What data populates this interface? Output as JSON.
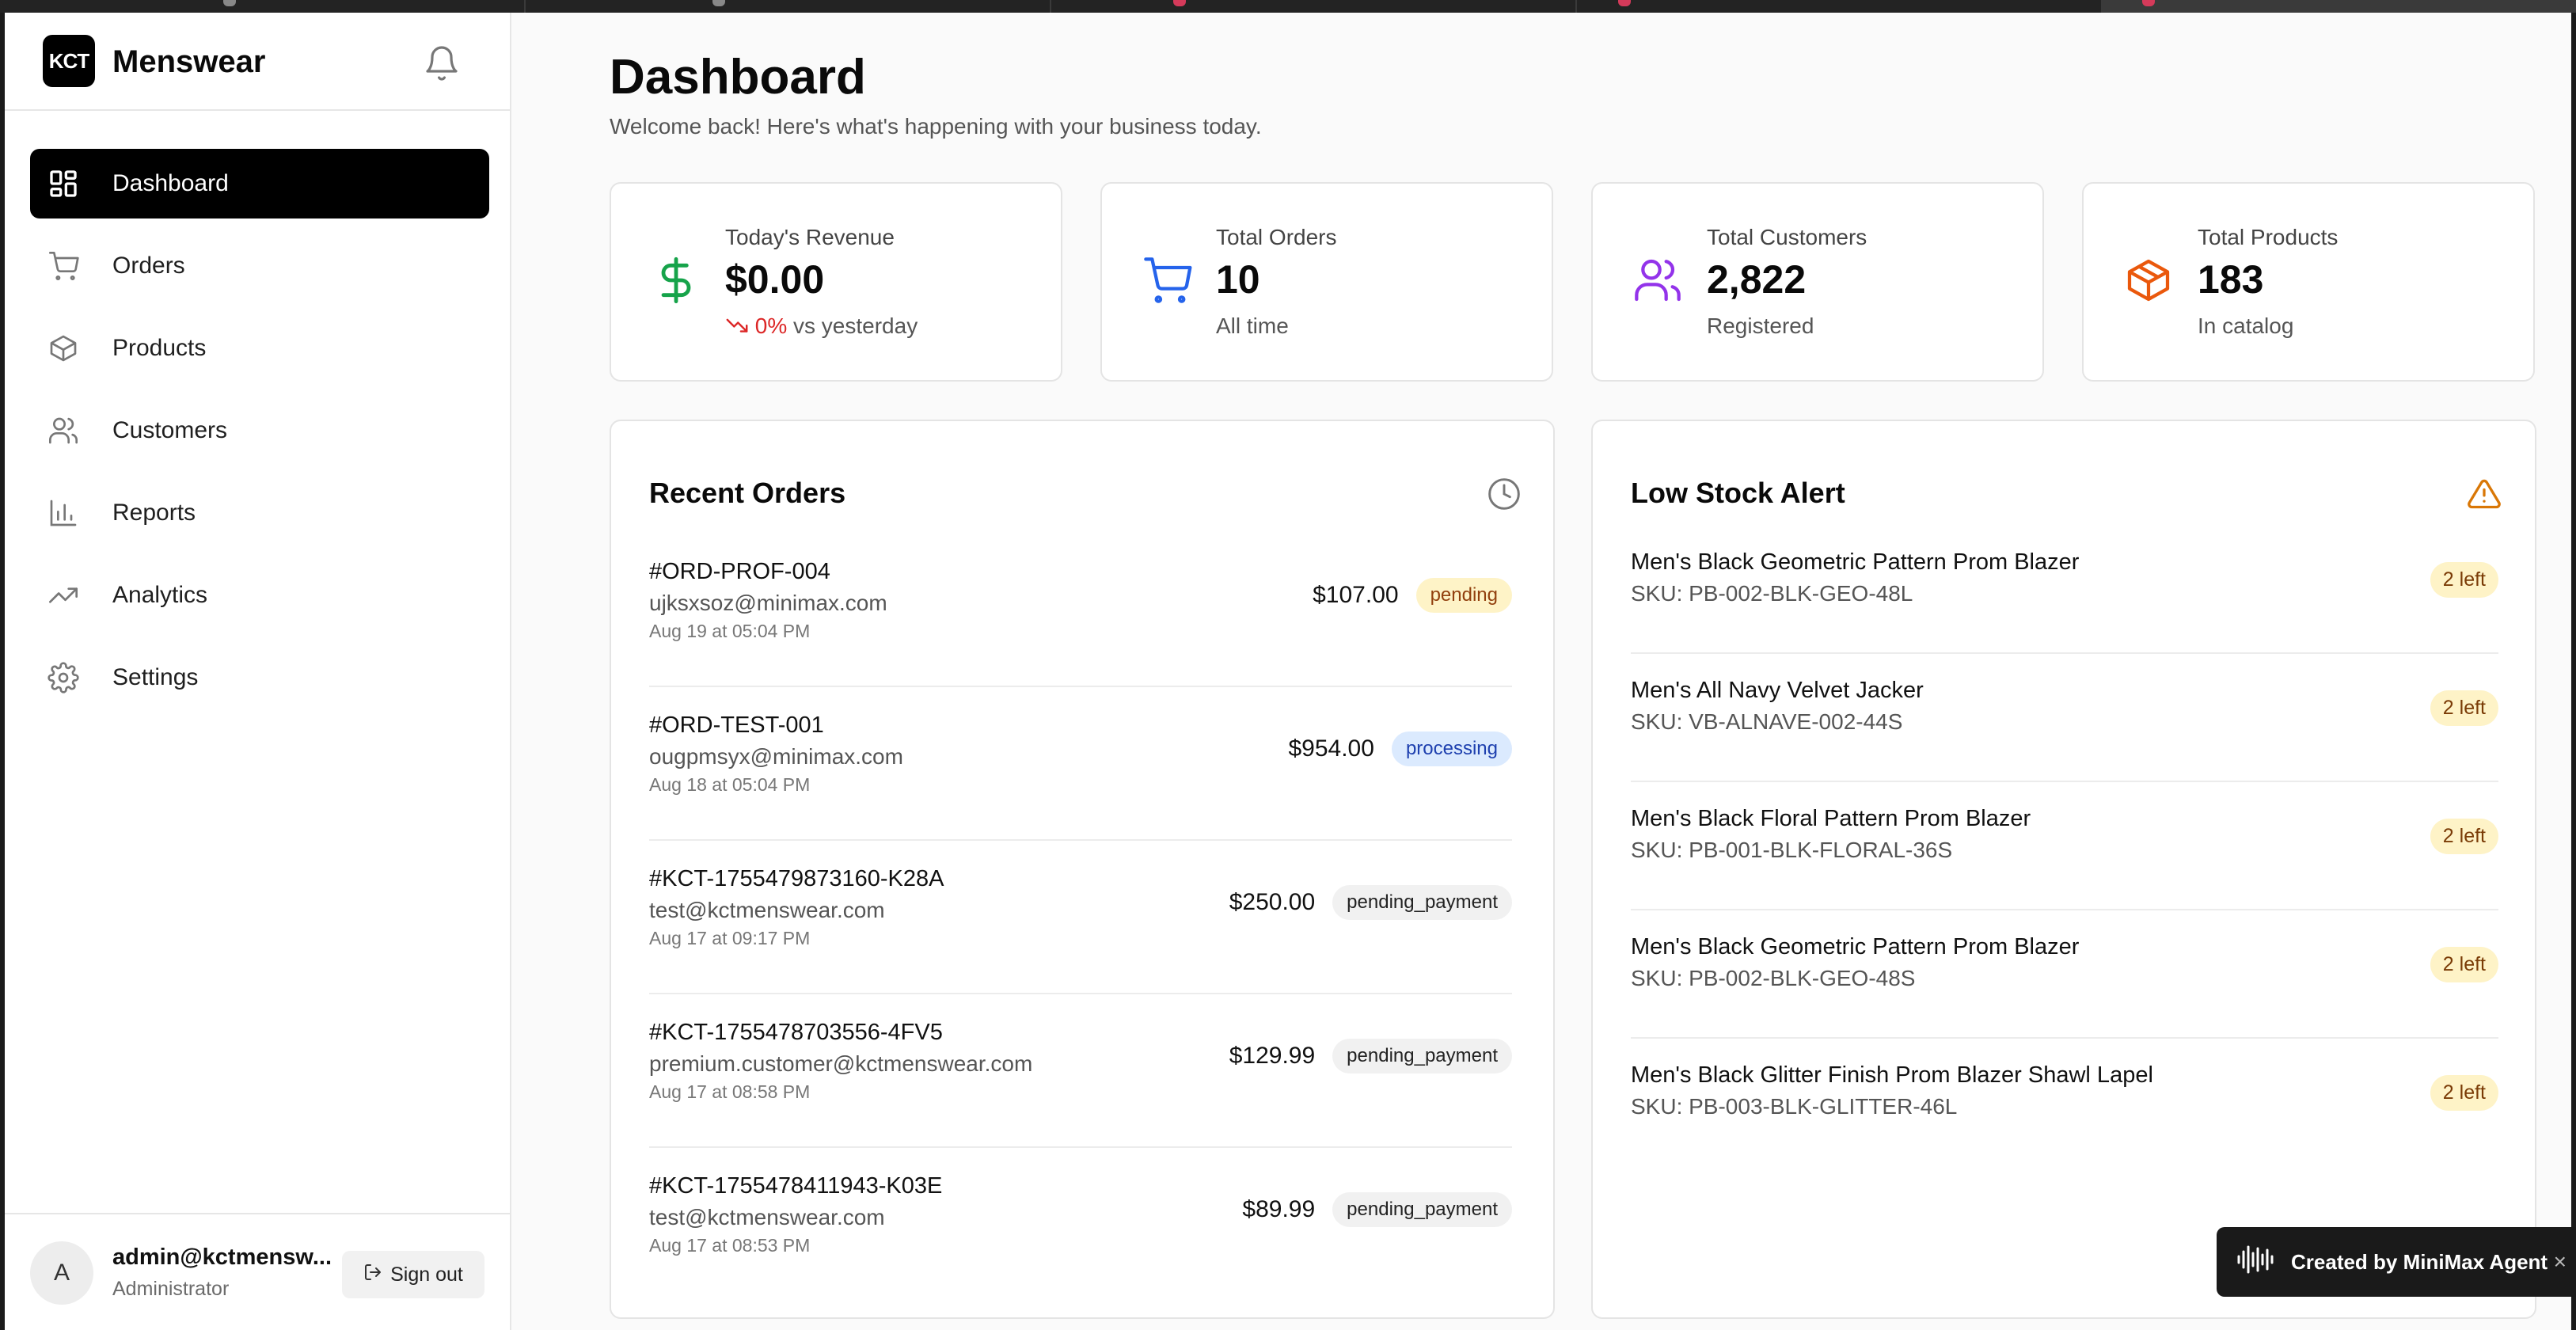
{
  "brand": {
    "logo_text": "KCT",
    "name": "Menswear"
  },
  "nav": [
    {
      "label": "Dashboard",
      "icon": "dashboard-grid-icon",
      "active": true
    },
    {
      "label": "Orders",
      "icon": "shopping-cart-icon"
    },
    {
      "label": "Products",
      "icon": "package-box-icon"
    },
    {
      "label": "Customers",
      "icon": "users-icon"
    },
    {
      "label": "Reports",
      "icon": "bar-chart-icon"
    },
    {
      "label": "Analytics",
      "icon": "trending-up-icon"
    },
    {
      "label": "Settings",
      "icon": "gear-icon"
    }
  ],
  "user": {
    "initial": "A",
    "email": "admin@kctmensw...",
    "role": "Administrator",
    "signout_label": "Sign out"
  },
  "header": {
    "title": "Dashboard",
    "subtitle": "Welcome back! Here's what's happening with your business today."
  },
  "stats": [
    {
      "label": "Today's Revenue",
      "value": "$0.00",
      "sub_pct": "0%",
      "sub_text": "vs yesterday",
      "icon": "dollar-sign-icon",
      "color": "#16a34a"
    },
    {
      "label": "Total Orders",
      "value": "10",
      "sub_text": "All time",
      "icon": "shopping-cart-icon",
      "color": "#2563eb"
    },
    {
      "label": "Total Customers",
      "value": "2,822",
      "sub_text": "Registered",
      "icon": "users-icon",
      "color": "#9333ea"
    },
    {
      "label": "Total Products",
      "value": "183",
      "sub_text": "In catalog",
      "icon": "package-box-icon",
      "color": "#ea580c"
    }
  ],
  "recent_orders": {
    "title": "Recent Orders",
    "rows": [
      {
        "id": "#ORD-PROF-004",
        "email": "ujksxsoz@minimax.com",
        "date": "Aug 19 at 05:04 PM",
        "amount": "$107.00",
        "status": "pending"
      },
      {
        "id": "#ORD-TEST-001",
        "email": "ougpmsyx@minimax.com",
        "date": "Aug 18 at 05:04 PM",
        "amount": "$954.00",
        "status": "processing"
      },
      {
        "id": "#KCT-1755479873160-K28A",
        "email": "test@kctmenswear.com",
        "date": "Aug 17 at 09:17 PM",
        "amount": "$250.00",
        "status": "pending_payment"
      },
      {
        "id": "#KCT-1755478703556-4FV5",
        "email": "premium.customer@kctmenswear.com",
        "date": "Aug 17 at 08:58 PM",
        "amount": "$129.99",
        "status": "pending_payment"
      },
      {
        "id": "#KCT-1755478411943-K03E",
        "email": "test@kctmenswear.com",
        "date": "Aug 17 at 08:53 PM",
        "amount": "$89.99",
        "status": "pending_payment"
      }
    ]
  },
  "low_stock": {
    "title": "Low Stock Alert",
    "rows": [
      {
        "name": "Men's Black Geometric Pattern Prom Blazer",
        "sku": "SKU: PB-002-BLK-GEO-48L",
        "left": "2 left"
      },
      {
        "name": "Men's All Navy Velvet Jacker",
        "sku": "SKU: VB-ALNAVE-002-44S",
        "left": "2 left"
      },
      {
        "name": "Men's Black Floral Pattern Prom Blazer",
        "sku": "SKU: PB-001-BLK-FLORAL-36S",
        "left": "2 left"
      },
      {
        "name": "Men's Black Geometric Pattern Prom Blazer",
        "sku": "SKU: PB-002-BLK-GEO-48S",
        "left": "2 left"
      },
      {
        "name": "Men's Black Glitter Finish Prom Blazer Shawl Lapel",
        "sku": "SKU: PB-003-BLK-GLITTER-46L",
        "left": "2 left"
      }
    ]
  },
  "toast": {
    "label": "Created by MiniMax Agent",
    "close": "×"
  }
}
